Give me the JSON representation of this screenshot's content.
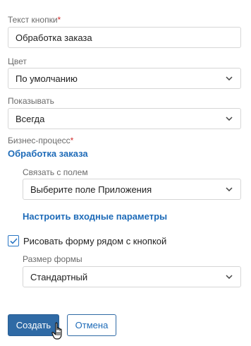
{
  "form": {
    "button_text": {
      "label": "Текст кнопки",
      "required_mark": "*",
      "value": "Обработка заказа"
    },
    "color": {
      "label": "Цвет",
      "value": "По умолчанию"
    },
    "show": {
      "label": "Показывать",
      "value": "Всегда"
    },
    "business_process": {
      "label": "Бизнес-процесс",
      "required_mark": "*",
      "value_link": "Обработка заказа",
      "bind_field": {
        "label": "Связать с полем",
        "value": "Выберите поле Приложения"
      },
      "configure_link": "Настроить входные параметры"
    },
    "draw_form": {
      "label": "Рисовать форму рядом с кнопкой",
      "checked": true,
      "size": {
        "label": "Размер формы",
        "value": "Стандартный"
      }
    }
  },
  "actions": {
    "create_label": "Создать",
    "cancel_label": "Отмена"
  },
  "colors": {
    "primary": "#2f6aa5",
    "link": "#1e6bb8",
    "required": "#d12d2d"
  },
  "icons": {
    "dropdown": "chevron-down-icon",
    "checkbox": "checkmark-icon",
    "cursor": "hand-pointer-icon"
  }
}
